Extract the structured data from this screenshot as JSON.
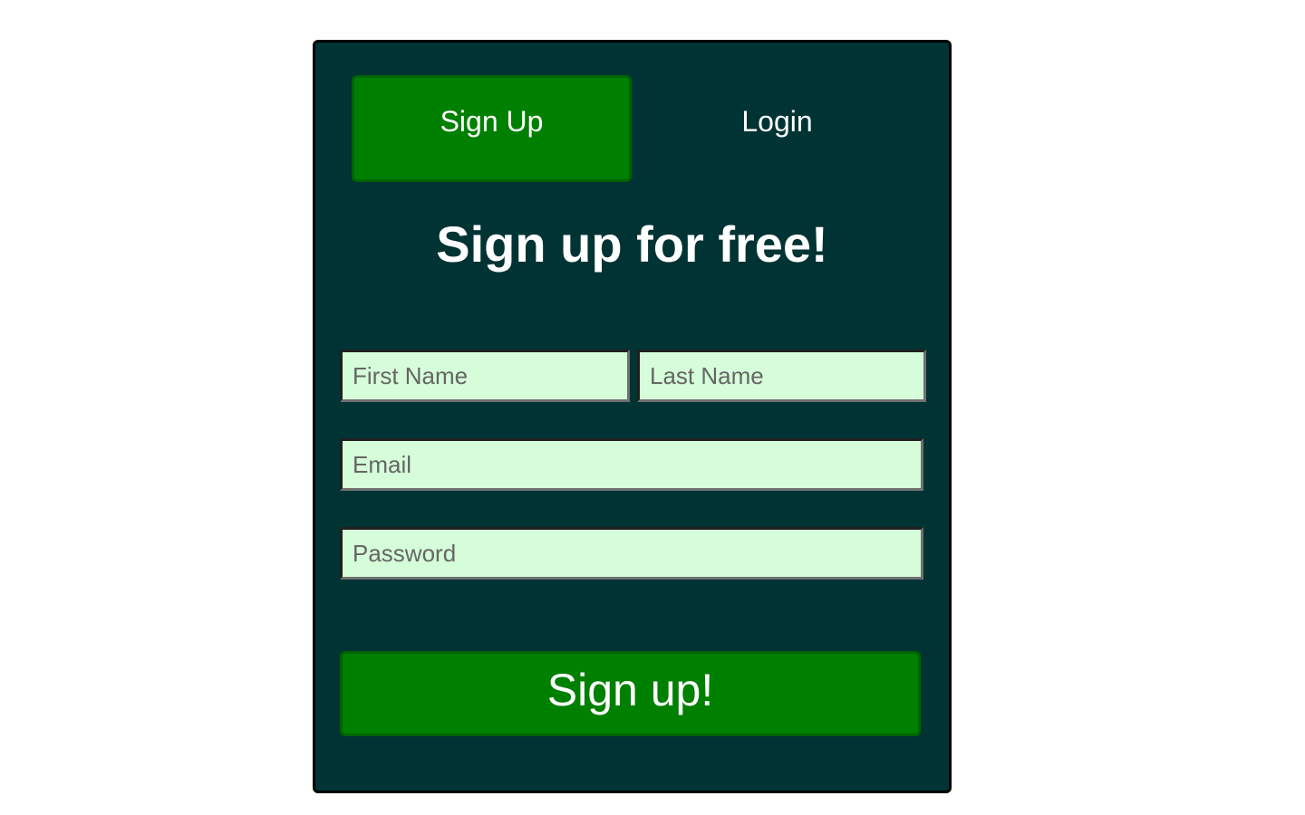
{
  "tabs": {
    "signup_label": "Sign Up",
    "login_label": "Login",
    "active": "signup"
  },
  "form": {
    "heading": "Sign up for free!",
    "first_name": {
      "value": "",
      "placeholder": "First Name"
    },
    "last_name": {
      "value": "",
      "placeholder": "Last Name"
    },
    "email": {
      "value": "",
      "placeholder": "Email"
    },
    "password": {
      "value": "",
      "placeholder": "Password"
    },
    "submit_label": "Sign up!"
  },
  "colors": {
    "card_background": "#003333",
    "accent_green": "#008000",
    "input_background": "#d5fdd9",
    "page_background": "#fefefe"
  }
}
